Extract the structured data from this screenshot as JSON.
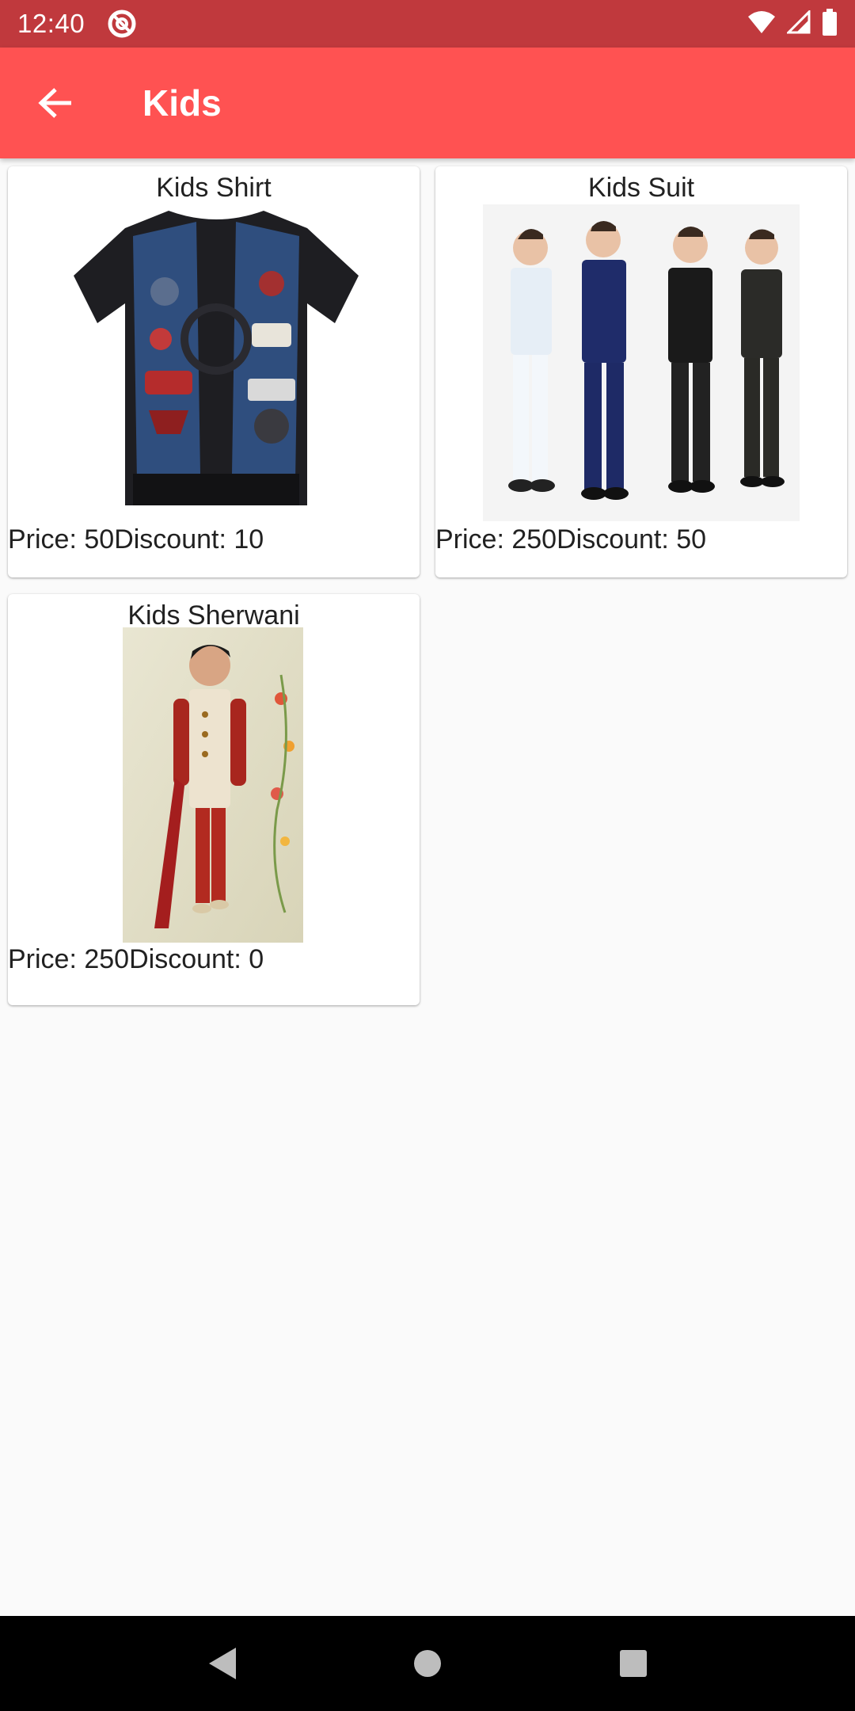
{
  "status_bar": {
    "time": "12:40"
  },
  "app_bar": {
    "title": "Kids"
  },
  "products": [
    {
      "name": "Kids Shirt",
      "price_label": "Price: 50",
      "discount_label": "Discount: 10"
    },
    {
      "name": "Kids Suit",
      "price_label": "Price: 250",
      "discount_label": "Discount: 50"
    },
    {
      "name": "Kids Sherwani",
      "price_label": "Price: 250",
      "discount_label": "Discount: 0"
    }
  ],
  "icons": {
    "back": "arrow-back-icon",
    "wifi": "wifi-icon",
    "signal": "signal-icon",
    "battery": "battery-icon",
    "nav_back": "nav-back-icon",
    "nav_home": "nav-home-icon",
    "nav_recents": "nav-recents-icon"
  },
  "colors": {
    "status_bar": "#C0393D",
    "app_bar": "#FF5252",
    "background": "#FAFAFA",
    "card": "#FFFFFF",
    "nav_bar": "#000000"
  }
}
